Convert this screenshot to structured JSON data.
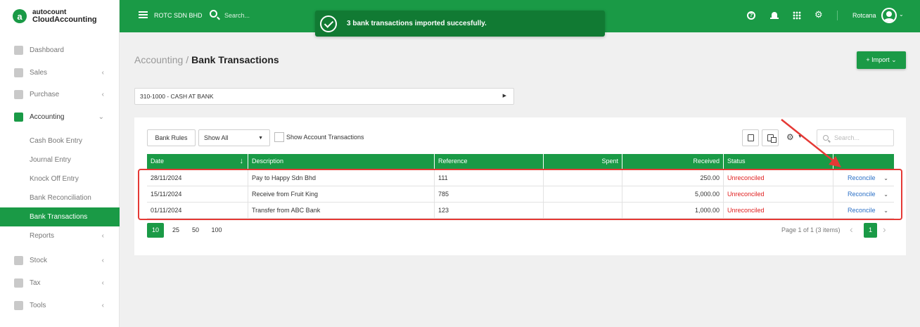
{
  "app": {
    "brand_top": "autocount",
    "brand_bottom": "CloudAccounting",
    "brand_letter": "a"
  },
  "topbar": {
    "company": "ROTC SDN BHD",
    "search_placeholder": "Search...",
    "toast_message": "3 bank transactions imported succesfully.",
    "username": "Rotcana",
    "icons": [
      "menu-icon",
      "search-icon",
      "help-icon",
      "bell-icon",
      "apps-grid-icon",
      "gear-icon",
      "avatar",
      "chevron-down-icon"
    ]
  },
  "sidebar": {
    "items": [
      {
        "label": "Dashboard",
        "icon": "dashboard-icon"
      },
      {
        "label": "Sales",
        "icon": "sales-icon",
        "chevron": "‹"
      },
      {
        "label": "Purchase",
        "icon": "purchase-icon",
        "chevron": "‹"
      },
      {
        "label": "Accounting",
        "icon": "accounting-icon",
        "chevron": "⌄"
      },
      {
        "label": "Reports",
        "chevron": "‹"
      },
      {
        "label": "Stock",
        "icon": "stock-icon",
        "chevron": "‹"
      },
      {
        "label": "Tax",
        "icon": "tax-icon",
        "chevron": "‹"
      },
      {
        "label": "Tools",
        "icon": "tools-icon",
        "chevron": "‹"
      }
    ],
    "accounting_sub": [
      {
        "label": "Cash Book Entry"
      },
      {
        "label": "Journal Entry"
      },
      {
        "label": "Knock Off Entry"
      },
      {
        "label": "Bank Reconciliation"
      },
      {
        "label": "Bank Transactions",
        "active": true
      }
    ]
  },
  "page": {
    "breadcrumb_root": "Accounting",
    "breadcrumb_sep": "/",
    "title": "Bank Transactions",
    "import_label": "+ Import ⌄",
    "account": "310-1000 - CASH AT BANK"
  },
  "toolbar": {
    "bank_rules_label": "Bank Rules",
    "filter_value": "Show All",
    "show_account_label": "Show Account Transactions",
    "search_placeholder": "Search..."
  },
  "table": {
    "columns": [
      "Date",
      "Description",
      "Reference",
      "Spent",
      "Received",
      "Status",
      ""
    ],
    "rows": [
      {
        "date": "28/11/2024",
        "description": "Pay to Happy Sdn Bhd",
        "reference": "111",
        "spent": "",
        "received": "250.00",
        "status": "Unreconciled",
        "action": "Reconcile"
      },
      {
        "date": "15/11/2024",
        "description": "Receive from Fruit King",
        "reference": "785",
        "spent": "",
        "received": "5,000.00",
        "status": "Unreconciled",
        "action": "Reconcile"
      },
      {
        "date": "01/11/2024",
        "description": "Transfer from ABC Bank",
        "reference": "123",
        "spent": "",
        "received": "1,000.00",
        "status": "Unreconciled",
        "action": "Reconcile"
      }
    ]
  },
  "pagination": {
    "page_sizes": [
      "10",
      "25",
      "50",
      "100"
    ],
    "active_page_size": "10",
    "info": "Page 1 of 1 (3 items)",
    "current_page": "1",
    "prev": "‹",
    "next": "›"
  },
  "colors": {
    "primary": "#1a9a46",
    "toast": "#117a33",
    "status_unreconciled": "#e02020",
    "link": "#2a6fc6",
    "annotation": "#e53935"
  }
}
